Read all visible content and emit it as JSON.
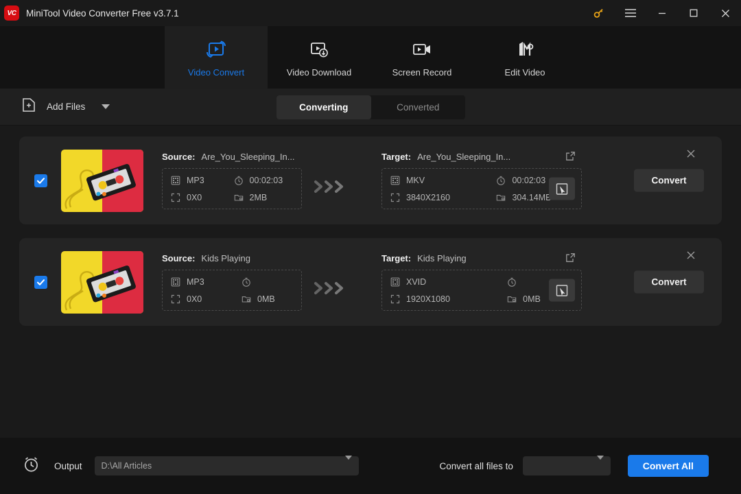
{
  "window": {
    "title": "MiniTool Video Converter Free v3.7.1",
    "logo_text": "VC",
    "controls": {
      "key_icon": "key-icon",
      "menu_icon": "hamburger-menu-icon",
      "minimize_icon": "minimize-icon",
      "maximize_icon": "maximize-icon",
      "close_icon": "close-icon"
    },
    "accent_color": "#1a7aea",
    "logo_color": "#d60d12",
    "key_color": "#e8a317"
  },
  "nav": {
    "tabs": [
      {
        "label": "Video Convert",
        "icon": "video-convert-icon",
        "active": true
      },
      {
        "label": "Video Download",
        "icon": "video-download-icon",
        "active": false
      },
      {
        "label": "Screen Record",
        "icon": "screen-record-icon",
        "active": false
      },
      {
        "label": "Edit Video",
        "icon": "edit-video-icon",
        "active": false
      }
    ]
  },
  "toolbar": {
    "add_files_label": "Add Files",
    "add_files_icon": "add-file-icon",
    "dropdown_icon": "chevron-down-icon",
    "segments": [
      {
        "label": "Converting",
        "active": true
      },
      {
        "label": "Converted",
        "active": false
      }
    ]
  },
  "files": [
    {
      "checked": true,
      "thumbnail": "cassette-tape-thumbnail",
      "source": {
        "key": "Source:",
        "name": "Are_You_Sleeping_In...",
        "format": "MP3",
        "duration": "00:02:03",
        "resolution": "0X0",
        "size": "2MB"
      },
      "target": {
        "key": "Target:",
        "name": "Are_You_Sleeping_In...",
        "format": "MKV",
        "duration": "00:02:03",
        "resolution": "3840X2160",
        "size": "304.14MB"
      },
      "convert_label": "Convert"
    },
    {
      "checked": true,
      "thumbnail": "cassette-tape-thumbnail",
      "source": {
        "key": "Source:",
        "name": "Kids Playing",
        "format": "MP3",
        "duration": "",
        "resolution": "0X0",
        "size": "0MB"
      },
      "target": {
        "key": "Target:",
        "name": "Kids Playing",
        "format": "XVID",
        "duration": "",
        "resolution": "1920X1080",
        "size": "0MB"
      },
      "convert_label": "Convert"
    }
  ],
  "icons": {
    "format_icon": "film-strip-icon",
    "duration_icon": "stopwatch-icon",
    "resolution_icon": "expand-arrows-icon",
    "size_icon": "folder-icon",
    "edit_icon": "edit-external-icon",
    "pick_icon": "select-cursor-icon",
    "arrows_icon": "triple-chevron-right-icon",
    "remove_icon": "close-icon"
  },
  "bottom": {
    "timer_icon": "alarm-clock-icon",
    "output_label": "Output",
    "output_path": "D:\\All Articles",
    "convert_all_to_label": "Convert all files to",
    "convert_all_to_value": "",
    "convert_all_button": "Convert All"
  }
}
